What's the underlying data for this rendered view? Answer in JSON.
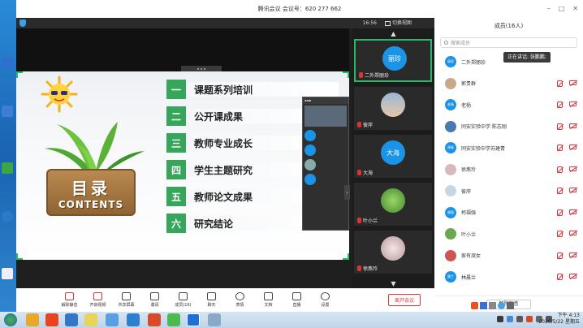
{
  "window": {
    "title": "腾讯会议 会议号：620 277 662"
  },
  "infobar": {
    "clock": "16:56",
    "gallery_label": "切换视图"
  },
  "slide": {
    "sign_title": "目录",
    "sign_sub": "CONTENTS",
    "items": [
      {
        "num": "一",
        "text": "课题系列培训"
      },
      {
        "num": "二",
        "text": "公开课成果"
      },
      {
        "num": "三",
        "text": "教师专业成长"
      },
      {
        "num": "四",
        "text": "学生主题研究"
      },
      {
        "num": "五",
        "text": "教师论文成果"
      },
      {
        "num": "六",
        "text": "研究结论"
      }
    ]
  },
  "videos": [
    {
      "name": "二外郑丽珍",
      "avatar_text": "丽珍",
      "color": "#1b93e6",
      "active": true
    },
    {
      "name": "彼岸",
      "avatar_text": "",
      "color": "#c7d6e4",
      "active": false
    },
    {
      "name": "大海",
      "avatar_text": "大海",
      "color": "#1b93e6",
      "active": false
    },
    {
      "name": "叶小兰",
      "avatar_text": "",
      "color": "#6aa84f",
      "active": false
    },
    {
      "name": "徐燕玲",
      "avatar_text": "",
      "color": "#d8b8b8",
      "active": false
    }
  ],
  "members": {
    "header": "成员(16人)",
    "search_placeholder": "搜索成员",
    "speaking": "正在讲话: 张鹏鹏;",
    "list": [
      {
        "name": "二外郑丽珍",
        "avatar_text": "丽珍",
        "color": "#1b93e6"
      },
      {
        "name": "郭贵群",
        "avatar_text": "",
        "color": "#c9a98a"
      },
      {
        "name": "老杨",
        "avatar_text": "老杨",
        "color": "#1b93e6"
      },
      {
        "name": "同安实验中学 陈志刚",
        "avatar_text": "",
        "color": "#4a7bb0"
      },
      {
        "name": "同安实验中学苏建青",
        "avatar_text": "建青",
        "color": "#1b93e6"
      },
      {
        "name": "徐燕玲",
        "avatar_text": "",
        "color": "#d8b8b8"
      },
      {
        "name": "彼岸",
        "avatar_text": "",
        "color": "#c7d6e4"
      },
      {
        "name": "柯福强",
        "avatar_text": "福强",
        "color": "#1b93e6"
      },
      {
        "name": "叶小兰",
        "avatar_text": "",
        "color": "#6aa84f"
      },
      {
        "name": "家有淑女",
        "avatar_text": "",
        "color": "#c55"
      },
      {
        "name": "林晨兰",
        "avatar_text": "晨兰",
        "color": "#1b93e6"
      }
    ],
    "unmute_all": "解除静音"
  },
  "toolbar": {
    "buttons": [
      {
        "label": "解除静音",
        "icon": "mic-off-icon",
        "red": true
      },
      {
        "label": "开启视频",
        "icon": "camera-off-icon",
        "red": true
      },
      {
        "label": "共享屏幕",
        "icon": "screen-share-icon",
        "red": false
      },
      {
        "label": "邀请",
        "icon": "invite-icon",
        "red": false
      },
      {
        "label": "成员(16)",
        "icon": "members-icon",
        "red": false
      },
      {
        "label": "聊天",
        "icon": "chat-icon",
        "red": false
      },
      {
        "label": "表情",
        "icon": "emoji-icon",
        "red": false
      },
      {
        "label": "文档",
        "icon": "document-icon",
        "red": false
      },
      {
        "label": "直播",
        "icon": "live-icon",
        "red": false
      },
      {
        "label": "设置",
        "icon": "settings-icon",
        "red": false
      }
    ],
    "leave": "离开会议"
  },
  "taskbar": {
    "time": "下午 4:13",
    "date": "2020/5/22 星期五"
  }
}
